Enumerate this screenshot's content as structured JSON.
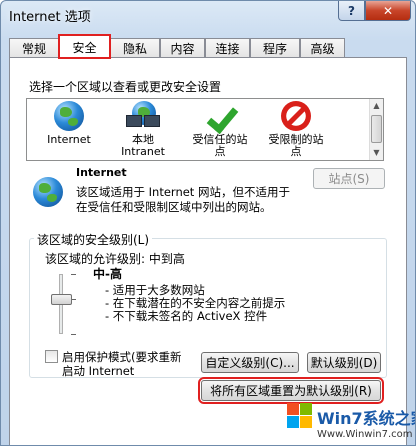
{
  "window": {
    "title": "Internet 选项",
    "help_label": "?",
    "close_label": "✕"
  },
  "tabs": [
    {
      "label": "常规"
    },
    {
      "label": "安全",
      "active": true
    },
    {
      "label": "隐私"
    },
    {
      "label": "内容"
    },
    {
      "label": "连接"
    },
    {
      "label": "程序"
    },
    {
      "label": "高级"
    }
  ],
  "security": {
    "zone_prompt": "选择一个区域以查看或更改安全设置",
    "zones": [
      {
        "label": "Internet",
        "icon": "globe-icon"
      },
      {
        "label": "本地\nIntranet",
        "icon": "intranet-icon"
      },
      {
        "label": "受信任的站\n点",
        "icon": "check-icon"
      },
      {
        "label": "受限制的站\n点",
        "icon": "no-entry-icon"
      }
    ],
    "selected_zone_title": "Internet",
    "selected_zone_desc_1": "该区域适用于 Internet 网站，但不适用于",
    "selected_zone_desc_2": "在受信任和受限制区域中列出的网站。",
    "sites_button": "站点(S)",
    "level_group_title": "该区域的安全级别(L)",
    "allowed_levels": "该区域的允许级别: 中到高",
    "level_name": "中-高",
    "level_desc": [
      "- 适用于大多数网站",
      "- 在下载潜在的不安全内容之前提示",
      "- 不下载未签名的 ActiveX 控件"
    ],
    "protected_mode_1": "启用保护模式(要求重新",
    "protected_mode_2": "启动 Internet",
    "custom_level_button": "自定义级别(C)...",
    "default_level_button": "默认级别(D)",
    "reset_all_button": "将所有区域重置为默认级别(R)"
  },
  "watermark": {
    "brand": "Win7系统之家",
    "url": "Www.Winwin7.com"
  },
  "colors": {
    "highlight": "#e02020",
    "accent": "#2b8ad8"
  }
}
